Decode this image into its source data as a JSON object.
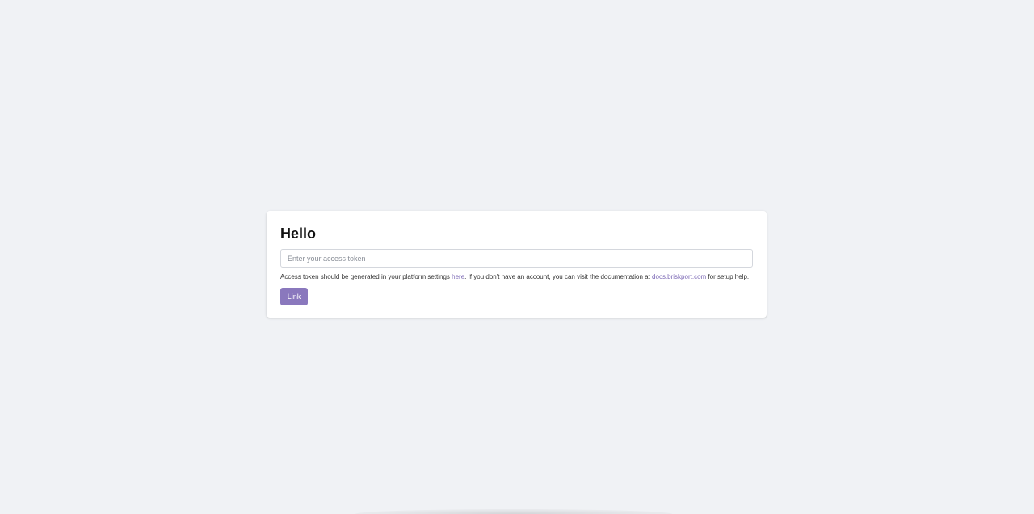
{
  "card": {
    "title": "Hello",
    "input": {
      "placeholder": "Enter your access token",
      "value": ""
    },
    "help": {
      "text_before": "Access token should be generated in your platform settings ",
      "settings_link": "here",
      "text_middle": ". If you don't have an account, you can visit the documentation at ",
      "docs_link": "docs.briskport.com",
      "text_after": " for setup help."
    },
    "button_label": "Link"
  },
  "colors": {
    "background": "#f0f2f5",
    "card": "#ffffff",
    "accent": "#8a78bd",
    "link": "#7b68b5"
  }
}
